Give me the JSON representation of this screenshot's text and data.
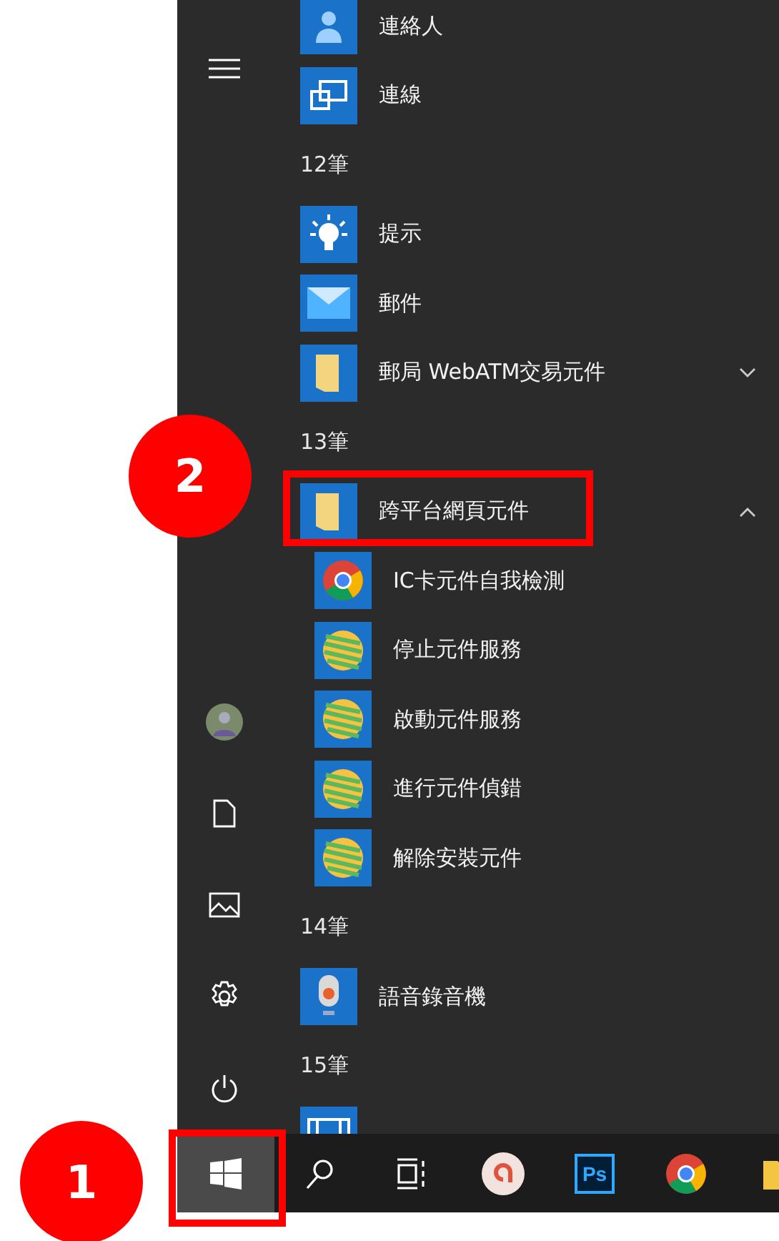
{
  "start_menu": {
    "items": [
      {
        "kind": "contacts",
        "label": "連絡人"
      },
      {
        "kind": "connect",
        "label": "連線"
      },
      {
        "kind": "header",
        "label": "12筆"
      },
      {
        "kind": "tips",
        "label": "提示"
      },
      {
        "kind": "mail",
        "label": "郵件"
      },
      {
        "kind": "folder",
        "label": "郵局 WebATM交易元件",
        "expanded": false
      },
      {
        "kind": "header",
        "label": "13筆"
      },
      {
        "kind": "folder",
        "label": "跨平台網頁元件",
        "expanded": true,
        "children": [
          {
            "kind": "chrome",
            "label": "IC卡元件自我檢測"
          },
          {
            "kind": "globe",
            "label": "停止元件服務"
          },
          {
            "kind": "globe",
            "label": "啟動元件服務"
          },
          {
            "kind": "globe",
            "label": "進行元件偵錯"
          },
          {
            "kind": "globe",
            "label": "解除安裝元件"
          }
        ]
      },
      {
        "kind": "header",
        "label": "14筆"
      },
      {
        "kind": "recorder",
        "label": "語音錄音機"
      },
      {
        "kind": "header",
        "label": "15筆"
      },
      {
        "kind": "video"
      }
    ]
  },
  "taskbar": {
    "start_selected": true,
    "apps": [
      {
        "kind": "search"
      },
      {
        "kind": "taskview"
      },
      {
        "kind": "app-a"
      },
      {
        "kind": "ps",
        "label": "Ps"
      },
      {
        "kind": "chrome"
      },
      {
        "kind": "folder"
      }
    ]
  },
  "annotations": [
    {
      "label": "2"
    },
    {
      "label": "1"
    }
  ]
}
